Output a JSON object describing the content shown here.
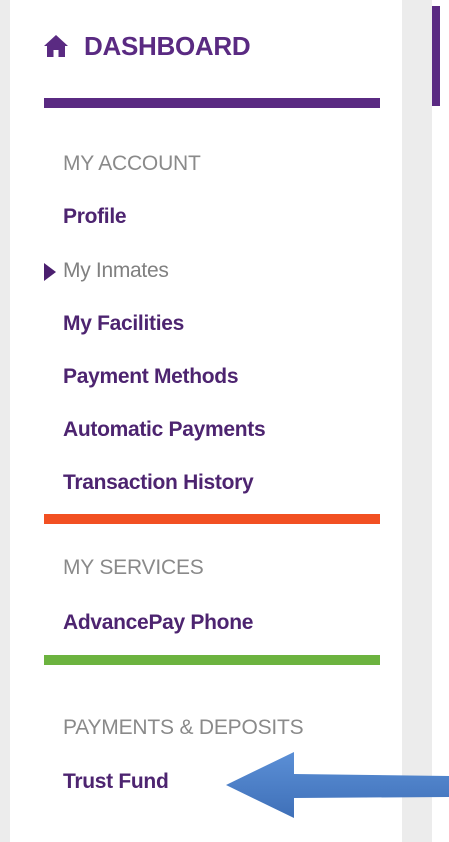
{
  "colors": {
    "brand_purple": "#5a2a82",
    "link_purple": "#4d2470",
    "muted_gray": "#8a8a8a",
    "account_bar": "#5a2a82",
    "transactions_bar": "#f25022",
    "services_bar": "#6cb33f",
    "arrow_blue": "#4a7fc8"
  },
  "sidebar": {
    "dashboard_label": "DASHBOARD",
    "dashboard_icon": "home-icon",
    "my_account": {
      "title": "MY ACCOUNT",
      "items": [
        {
          "label": "Profile",
          "current": false
        },
        {
          "label": "My Inmates",
          "current": true
        },
        {
          "label": "My Facilities",
          "current": false
        },
        {
          "label": "Payment Methods",
          "current": false
        },
        {
          "label": "Automatic Payments",
          "current": false
        },
        {
          "label": "Transaction History",
          "current": false
        }
      ]
    },
    "my_services": {
      "title": "MY SERVICES",
      "items": [
        {
          "label": "AdvancePay Phone"
        }
      ]
    },
    "payments_deposits": {
      "title": "PAYMENTS & DEPOSITS",
      "items": [
        {
          "label": "Trust Fund"
        }
      ]
    }
  },
  "annotation": {
    "arrow_icon": "arrow-left-icon"
  }
}
